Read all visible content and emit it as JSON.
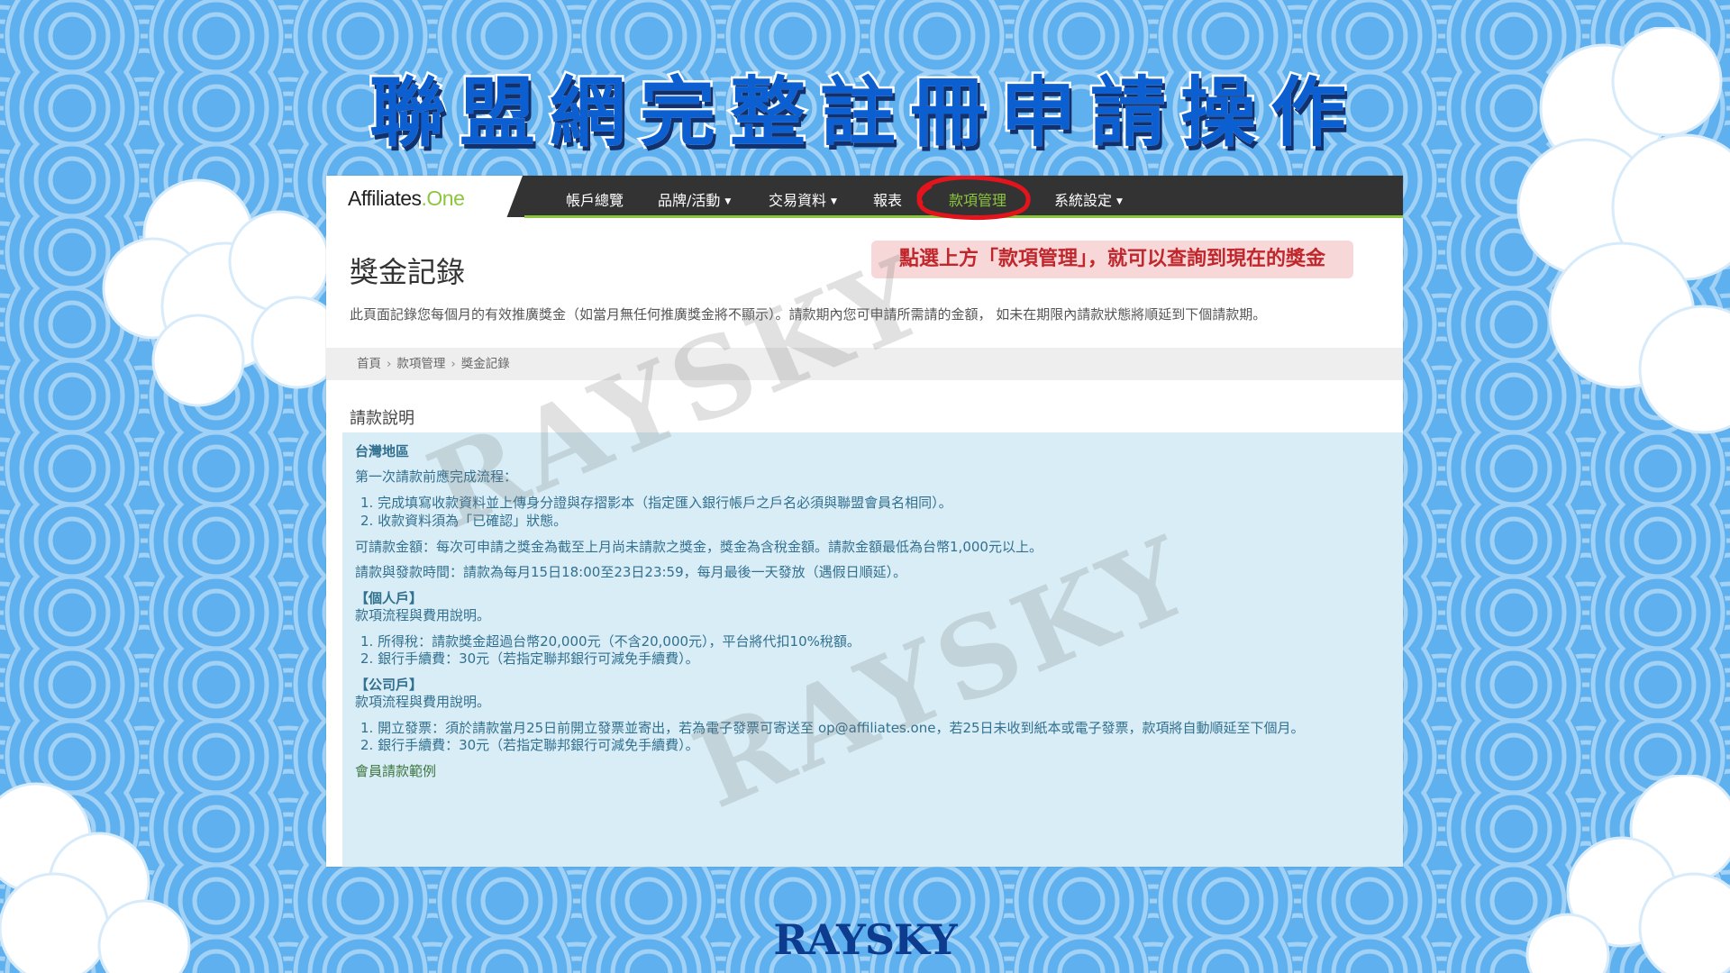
{
  "slide": {
    "headline": "聯盟網完整註冊申請操作",
    "brand": "RAYSKY",
    "watermark": "RAYSKY"
  },
  "navbar": {
    "logo": "Affiliates",
    "logo_dot": ".",
    "logo_suffix": "One",
    "items": [
      {
        "label": "帳戶總覽",
        "dropdown": false
      },
      {
        "label": "品牌/活動",
        "dropdown": true
      },
      {
        "label": "交易資料",
        "dropdown": true
      },
      {
        "label": "報表",
        "dropdown": false
      },
      {
        "label": "款項管理",
        "dropdown": false,
        "active": true
      },
      {
        "label": "系統設定",
        "dropdown": true
      }
    ],
    "accent_color": "#8cc63f",
    "highlight_color": "#e3141c"
  },
  "page": {
    "title": "獎金記錄",
    "callout": "點選上方「款項管理」，就可以查詢到現在的獎金",
    "intro": "此頁面記錄您每個月的有效推廣獎金（如當月無任何推廣獎金將不顯示）。請款期內您可申請所需請的金額， 如未在期限內請款狀態將順延到下個請款期。",
    "breadcrumb": [
      "首頁",
      "款項管理",
      "獎金記錄"
    ],
    "section_title": "請款說明"
  },
  "info": {
    "region": "台灣地區",
    "first_time_heading": "第一次請款前應完成流程：",
    "first_time_steps": [
      "1.  完成填寫收款資料並上傳身分證與存摺影本（指定匯入銀行帳戶之戶名必須與聯盟會員名相同）。",
      "2.  收款資料須為「已確認」狀態。"
    ],
    "amount_rule": "可請款金額：每次可申請之獎金為截至上月尚未請款之獎金，獎金為含稅金額。請款金額最低為台幣1,000元以上。",
    "schedule_rule": "請款與發款時間：請款為每月15日18:00至23日23:59，每月最後一天發放（遇假日順延）。",
    "individual": {
      "heading": "【個人戶】",
      "sub": "款項流程與費用說明。",
      "items": [
        "1.  所得稅：請款獎金超過台幣20,000元（不含20,000元），平台將代扣10%稅額。",
        "2.  銀行手續費：30元（若指定聯邦銀行可減免手續費）。"
      ]
    },
    "company": {
      "heading": "【公司戶】",
      "sub": "款項流程與費用說明。",
      "items": [
        "1.  開立發票：須於請款當月25日前開立發票並寄出，若為電子發票可寄送至 op@affiliates.one，若25日未收到紙本或電子發票，款項將自動順延至下個月。",
        "2.  銀行手續費：30元（若指定聯邦銀行可減免手續費）。"
      ]
    },
    "example_link": "會員請款範例"
  }
}
